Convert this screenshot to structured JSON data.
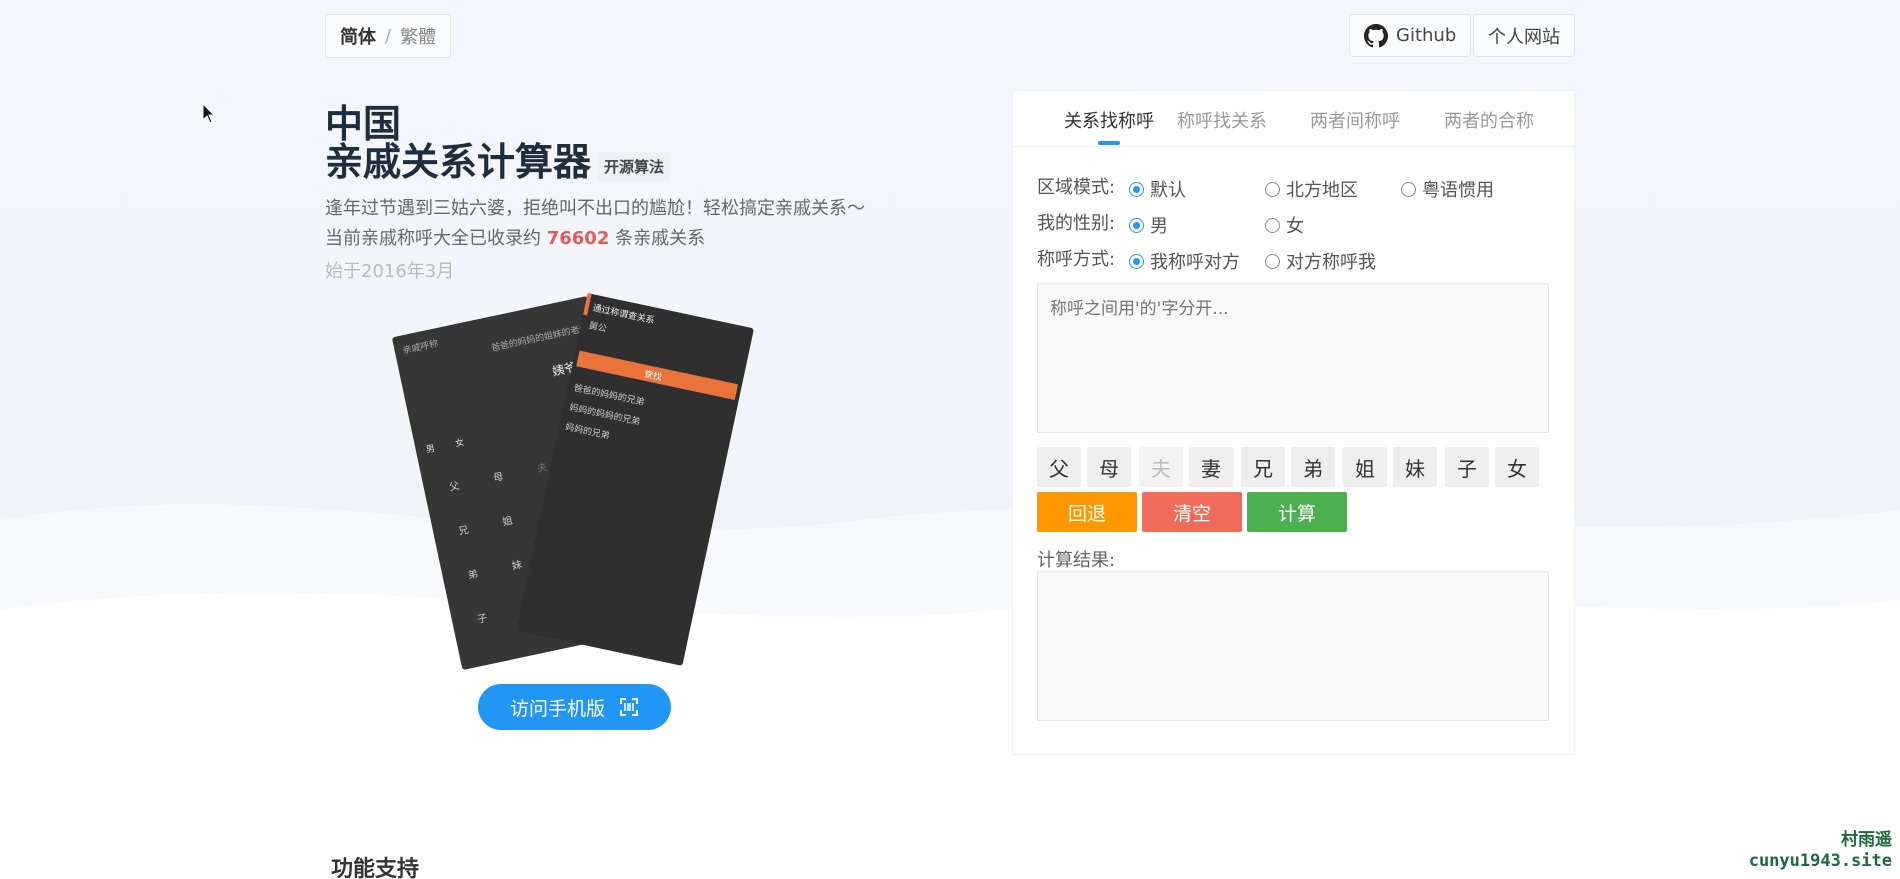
{
  "header": {
    "lang_current": "简体",
    "lang_sep": "/",
    "lang_alt": "繁體",
    "github_label": "Github",
    "website_label": "个人网站"
  },
  "hero": {
    "title_line1": "中国",
    "title_line2": "亲戚关系计算器",
    "badge": "开源算法",
    "desc1": "逢年过节遇到三姑六婆，拒绝叫不出口的尴尬！轻松搞定亲戚关系～",
    "desc2_prefix": "当前亲戚称呼大全已收录约",
    "desc2_count": "76602",
    "desc2_suffix": "条亲戚关系",
    "since": "始于2016年3月",
    "mobile_button": "访问手机版"
  },
  "phone_screens": {
    "left_top": "亲戚呼称",
    "left_result": "姨爷爷",
    "left_sub": "爸爸的妈妈的姐妹的老公",
    "left_gender": "男",
    "left_gender2": "女",
    "right_title": "通过称谓查关系",
    "right_input": "舅公",
    "right_button": "查找",
    "right_item1": "爸爸的妈妈的兄弟",
    "right_item2": "妈妈的妈妈的兄弟",
    "right_item3": "妈妈的兄弟"
  },
  "calculator": {
    "tabs": [
      "关系找称呼",
      "称呼找关系",
      "两者间称呼",
      "两者的合称"
    ],
    "active_tab": 0,
    "region_label": "区域模式:",
    "region_options": [
      "默认",
      "北方地区",
      "粤语惯用"
    ],
    "region_selected": 0,
    "gender_label": "我的性别:",
    "gender_options": [
      "男",
      "女"
    ],
    "gender_selected": 0,
    "call_label": "称呼方式:",
    "call_options": [
      "我称呼对方",
      "对方称呼我"
    ],
    "call_selected": 0,
    "input_placeholder": "称呼之间用'的'字分开...",
    "keys": [
      "父",
      "母",
      "夫",
      "妻",
      "兄",
      "弟",
      "姐",
      "妹",
      "子",
      "女"
    ],
    "disabled_key": "夫",
    "back_label": "回退",
    "clear_label": "清空",
    "calc_label": "计算",
    "result_label": "计算结果:",
    "colors": {
      "back": "#ff9800",
      "clear": "#f06b5a",
      "calc": "#4caf50",
      "accent": "#2196f3"
    }
  },
  "section_title": "功能支持",
  "watermark": {
    "line1": "村雨遥",
    "line2": "cunyu1943.site"
  }
}
